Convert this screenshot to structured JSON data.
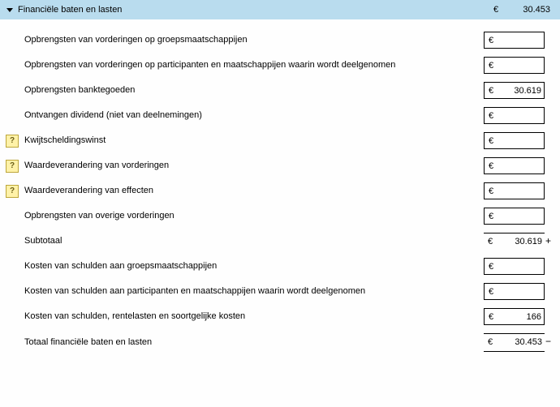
{
  "header": {
    "title": "Financiële baten en lasten",
    "currency": "€",
    "amount": "30.453"
  },
  "currency": "€",
  "rows": {
    "r1": {
      "label": "Opbrengsten van vorderingen op groepsmaatschappijen",
      "value": ""
    },
    "r2": {
      "label": "Opbrengsten van vorderingen op participanten en maatschappijen waarin wordt deelgenomen",
      "value": ""
    },
    "r3": {
      "label": "Opbrengsten banktegoeden",
      "value": "30.619"
    },
    "r4": {
      "label": "Ontvangen dividend (niet van deelnemingen)",
      "value": ""
    },
    "r5": {
      "label": "Kwijtscheldingswinst",
      "value": ""
    },
    "r6": {
      "label": "Waardeverandering van vorderingen",
      "value": ""
    },
    "r7": {
      "label": "Waardeverandering van effecten",
      "value": ""
    },
    "r8": {
      "label": "Opbrengsten van overige vorderingen",
      "value": ""
    },
    "sub": {
      "label": "Subtotaal",
      "value": "30.619",
      "sign": "+"
    },
    "r9": {
      "label": "Kosten van schulden aan groepsmaatschappijen",
      "value": ""
    },
    "r10": {
      "label": "Kosten van schulden aan participanten en maatschappijen waarin wordt deelgenomen",
      "value": ""
    },
    "r11": {
      "label": "Kosten van schulden, rentelasten en soortgelijke kosten",
      "value": "166"
    },
    "tot": {
      "label": "Totaal financiële baten en lasten",
      "value": "30.453",
      "sign": "−"
    }
  },
  "hint_glyph": "?"
}
